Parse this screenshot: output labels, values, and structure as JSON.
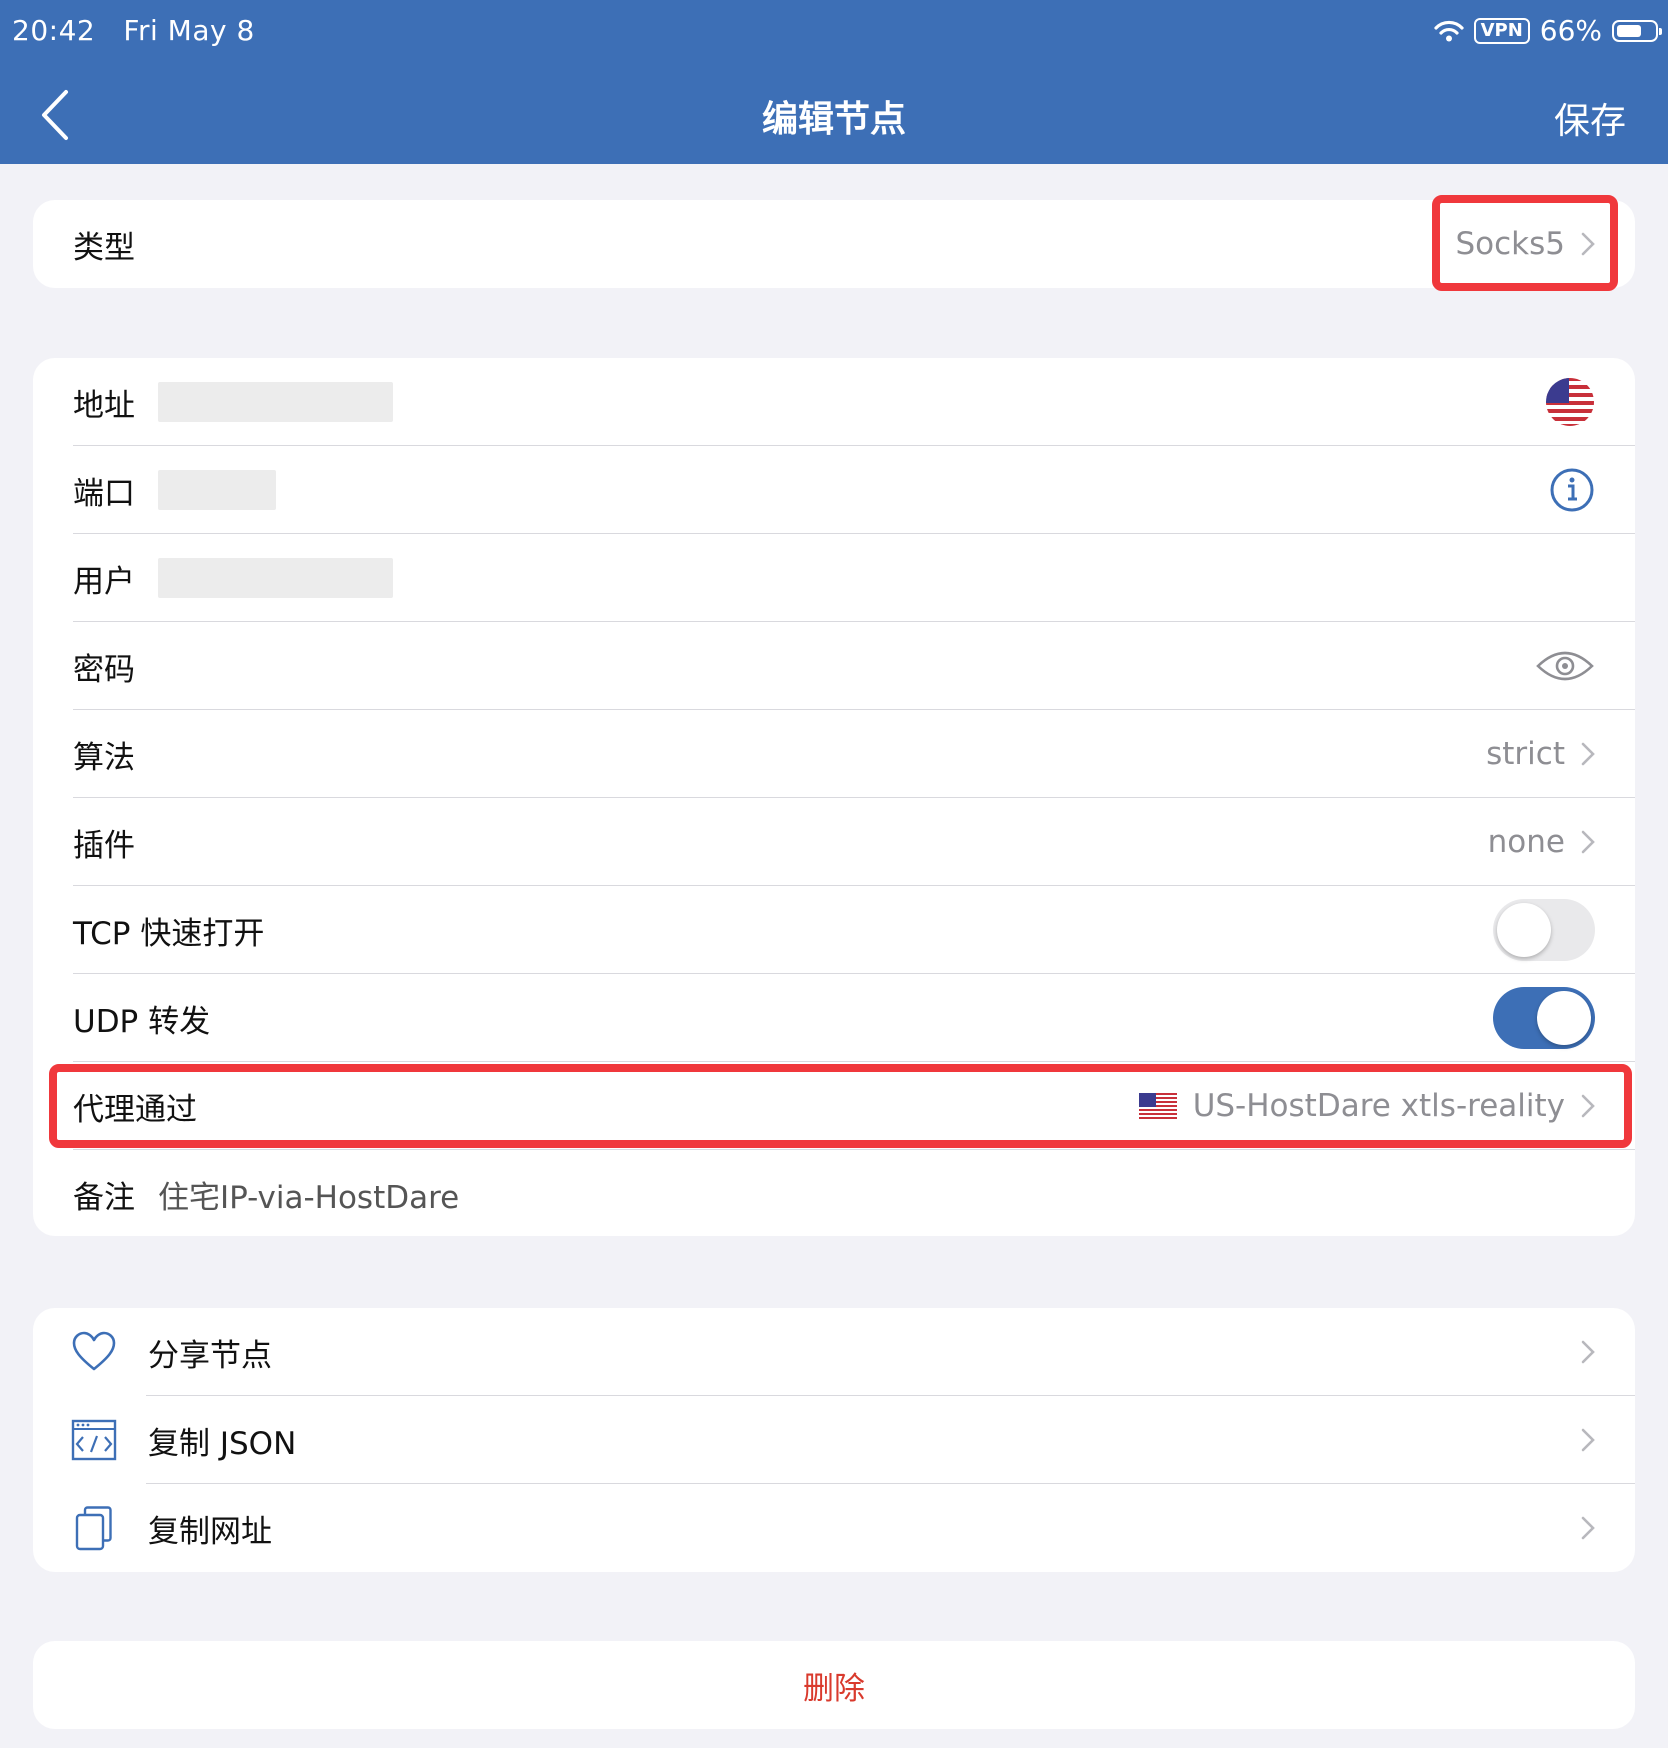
{
  "status_bar": {
    "time": "20:42",
    "date": "Fri May 8",
    "vpn": "VPN",
    "battery": "66%",
    "battery_level": 0.66
  },
  "nav": {
    "title": "编辑节点",
    "save": "保存"
  },
  "type_row": {
    "label": "类型",
    "value": "Socks5"
  },
  "fields": {
    "address": {
      "label": "地址"
    },
    "port": {
      "label": "端口"
    },
    "user": {
      "label": "用户"
    },
    "password": {
      "label": "密码"
    },
    "algorithm": {
      "label": "算法",
      "value": "strict"
    },
    "plugin": {
      "label": "插件",
      "value": "none"
    },
    "tcp_fast_open": {
      "label": "TCP 快速打开",
      "on": false
    },
    "udp_forward": {
      "label": "UDP 转发",
      "on": true
    },
    "proxy_via": {
      "label": "代理通过",
      "value": "US-HostDare xtls-reality"
    },
    "note": {
      "label": "备注",
      "value": "住宅IP-via-HostDare"
    }
  },
  "actions": [
    {
      "label": "分享节点",
      "icon": "heart-icon"
    },
    {
      "label": "复制 JSON",
      "icon": "code-window-icon"
    },
    {
      "label": "复制网址",
      "icon": "copy-icon"
    }
  ],
  "delete": {
    "label": "删除"
  },
  "colors": {
    "header": "#3d6fb6",
    "highlight": "#f0383c",
    "destructive": "#d93a2d"
  }
}
